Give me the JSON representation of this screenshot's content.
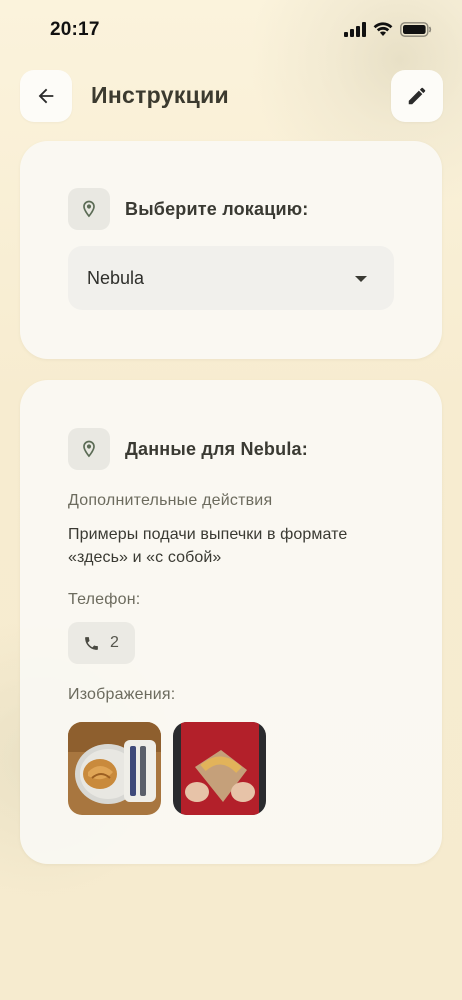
{
  "status_bar": {
    "time": "20:17"
  },
  "header": {
    "title": "Инструкции"
  },
  "location_card": {
    "label": "Выберите локацию:",
    "selected_location": "Nebula"
  },
  "details_card": {
    "title": "Данные для Nebula:",
    "actions_label": "Дополнительные действия",
    "actions_text": "Примеры подачи выпечки в формате «здесь» и «с собой»",
    "phone_label": "Телефон:",
    "phone_value": "2",
    "images_label": "Изображения:"
  },
  "icons": [
    "arrow-left-icon",
    "pencil-icon",
    "location-pin-icon",
    "chevron-down-icon",
    "phone-icon"
  ],
  "colors": {
    "background": "#f6ecd0",
    "card": "#faf9f4",
    "accent_icon": "#5b6b55"
  }
}
